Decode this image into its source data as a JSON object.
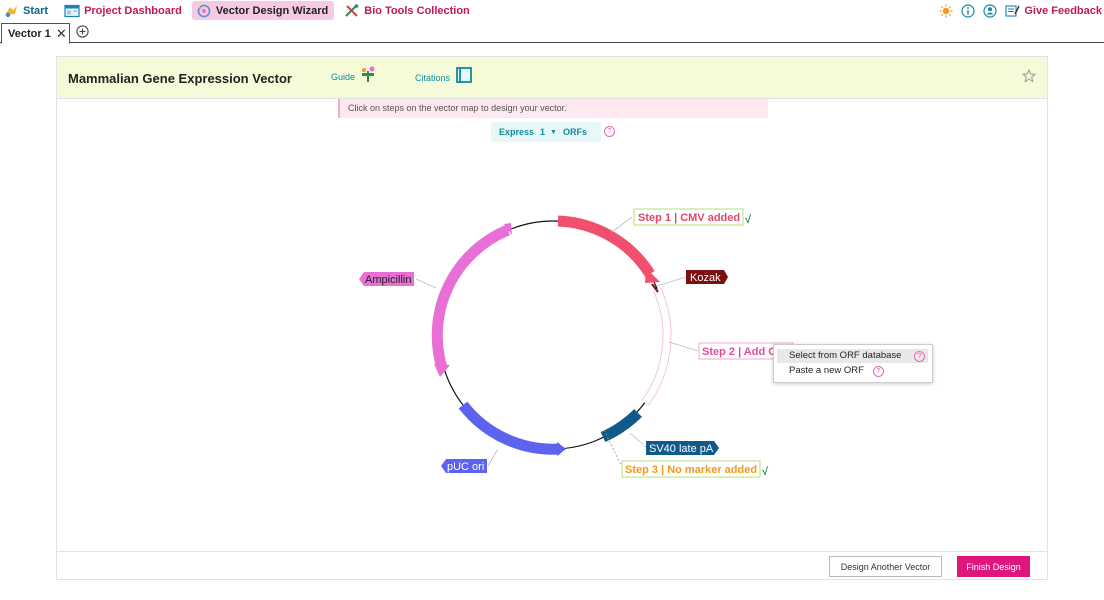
{
  "nav": {
    "start": "Start",
    "dashboard": "Project Dashboard",
    "wizard": "Vector Design Wizard",
    "tools": "Bio Tools Collection",
    "feedback": "Give Feedback"
  },
  "tabs": [
    {
      "label": "Vector 1"
    }
  ],
  "panel": {
    "title": "Mammalian Gene Expression Vector",
    "guide": "Guide",
    "citations": "Citations",
    "hint": "Click on steps on the vector map to design your vector.",
    "express_label": "Express",
    "express_count": "1",
    "express_suffix": "ORFs"
  },
  "map": {
    "step1": "Step 1 | CMV added",
    "kozak": "Kozak",
    "step2": "Step 2 | Add O",
    "sv40": "SV40 late pA",
    "step3": "Step 3 | No marker added",
    "amp": "Ampicillin",
    "puc": "pUC ori",
    "check": "√"
  },
  "popup": {
    "select_orf": "Select from ORF database",
    "paste_orf": "Paste a new ORF"
  },
  "footer": {
    "design_another": "Design Another Vector",
    "finish": "Finish Design"
  },
  "colors": {
    "accent": "#e0157d",
    "teal": "#0f8c9a",
    "cmv": "#f0506e",
    "amp": "#e86fd6",
    "puc": "#5d63ef",
    "sv40": "#0e5a8a",
    "kozak": "#7a1010"
  }
}
